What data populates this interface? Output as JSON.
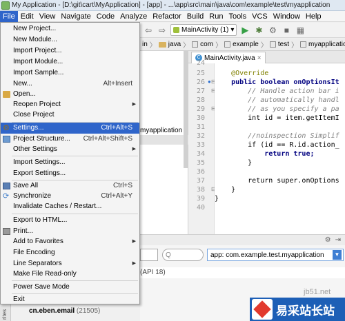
{
  "window": {
    "title": "My Application - [D:\\git\\cart\\MyApplication] - [app] - ...\\app\\src\\main\\java\\com\\example\\test\\myapplication"
  },
  "menubar": [
    "File",
    "Edit",
    "View",
    "Navigate",
    "Code",
    "Analyze",
    "Refactor",
    "Build",
    "Run",
    "Tools",
    "VCS",
    "Window",
    "Help"
  ],
  "toolbar": {
    "run_config": "MainActivity (1)"
  },
  "breadcrumb": [
    "in",
    "java",
    "com",
    "example",
    "test",
    "myapplication"
  ],
  "project_pane": {
    "row": "myapplication"
  },
  "editor": {
    "tab": "MainActivity.java",
    "line_numbers": [
      "24",
      "25",
      "26",
      "27",
      "28",
      "29",
      "30",
      "31",
      "32",
      "33",
      "34",
      "35",
      "36",
      "37",
      "38",
      "39",
      "40"
    ],
    "code": [
      "    ",
      "    @Override",
      "    public boolean onOptionsIt",
      "        // Handle action bar i",
      "        // automatically handl",
      "        // as you specify a pa",
      "        int id = item.getItemI",
      "",
      "        //noinspection Simplif",
      "        if (id == R.id.action_",
      "            return true;",
      "        }",
      "",
      "        return super.onOptions",
      "    }",
      "}",
      ""
    ]
  },
  "file_menu": {
    "items": [
      {
        "label": "New Project...",
        "shortcut": ""
      },
      {
        "label": "New Module...",
        "shortcut": ""
      },
      {
        "label": "Import Project...",
        "shortcut": ""
      },
      {
        "label": "Import Module...",
        "shortcut": ""
      },
      {
        "label": "Import Sample...",
        "shortcut": ""
      },
      {
        "label": "New...",
        "shortcut": "Alt+Insert"
      },
      {
        "label": "Open...",
        "shortcut": ""
      },
      {
        "label": "Reopen Project",
        "shortcut": ""
      },
      {
        "label": "Close Project",
        "shortcut": ""
      },
      {
        "label": "Settings...",
        "shortcut": "Ctrl+Alt+S"
      },
      {
        "label": "Project Structure...",
        "shortcut": "Ctrl+Alt+Shift+S"
      },
      {
        "label": "Other Settings",
        "shortcut": ""
      },
      {
        "label": "Import Settings...",
        "shortcut": ""
      },
      {
        "label": "Export Settings...",
        "shortcut": ""
      },
      {
        "label": "Save All",
        "shortcut": "Ctrl+S"
      },
      {
        "label": "Synchronize",
        "shortcut": "Ctrl+Alt+Y"
      },
      {
        "label": "Invalidate Caches / Restart...",
        "shortcut": ""
      },
      {
        "label": "Export to HTML...",
        "shortcut": ""
      },
      {
        "label": "Print...",
        "shortcut": ""
      },
      {
        "label": "Add to Favorites",
        "shortcut": ""
      },
      {
        "label": "File Encoding",
        "shortcut": ""
      },
      {
        "label": "Line Separators",
        "shortcut": ""
      },
      {
        "label": "Make File Read-only",
        "shortcut": ""
      },
      {
        "label": "Power Save Mode",
        "shortcut": ""
      },
      {
        "label": "Exit",
        "shortcut": ""
      }
    ]
  },
  "logcat": {
    "search_placeholder": "Q",
    "app_select": "app: com.example.test.myapplication",
    "api_row": "(API 18)",
    "processes": [
      "cn.eben.email",
      "(21505)"
    ]
  },
  "sidebar_strip": "rites",
  "watermark": {
    "url": "jb51.net",
    "brand": "易采站长站"
  },
  "colors": {
    "selection": "#2f65ca",
    "keyword": "#000080",
    "annotation": "#808000",
    "comment": "#808080"
  }
}
